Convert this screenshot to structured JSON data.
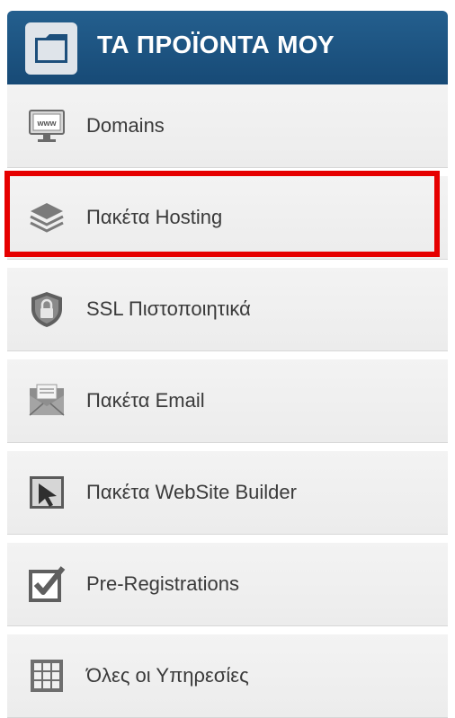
{
  "header": {
    "title": "ΤΑ ΠΡΟΪΟΝΤΑ ΜΟΥ",
    "icon": "folder-icon"
  },
  "menu": {
    "items": [
      {
        "label": "Domains",
        "icon": "www-monitor-icon"
      },
      {
        "label": "Πακέτα Hosting",
        "icon": "layers-icon"
      },
      {
        "label": "SSL Πιστοποιητικά",
        "icon": "shield-lock-icon"
      },
      {
        "label": "Πακέτα Email",
        "icon": "envelope-icon"
      },
      {
        "label": "Πακέτα WebSite Builder",
        "icon": "cursor-icon"
      },
      {
        "label": "Pre-Registrations",
        "icon": "checkbox-icon"
      },
      {
        "label": "Όλες οι Υπηρεσίες",
        "icon": "grid-icon"
      }
    ]
  },
  "highlight_color": "#e60000"
}
